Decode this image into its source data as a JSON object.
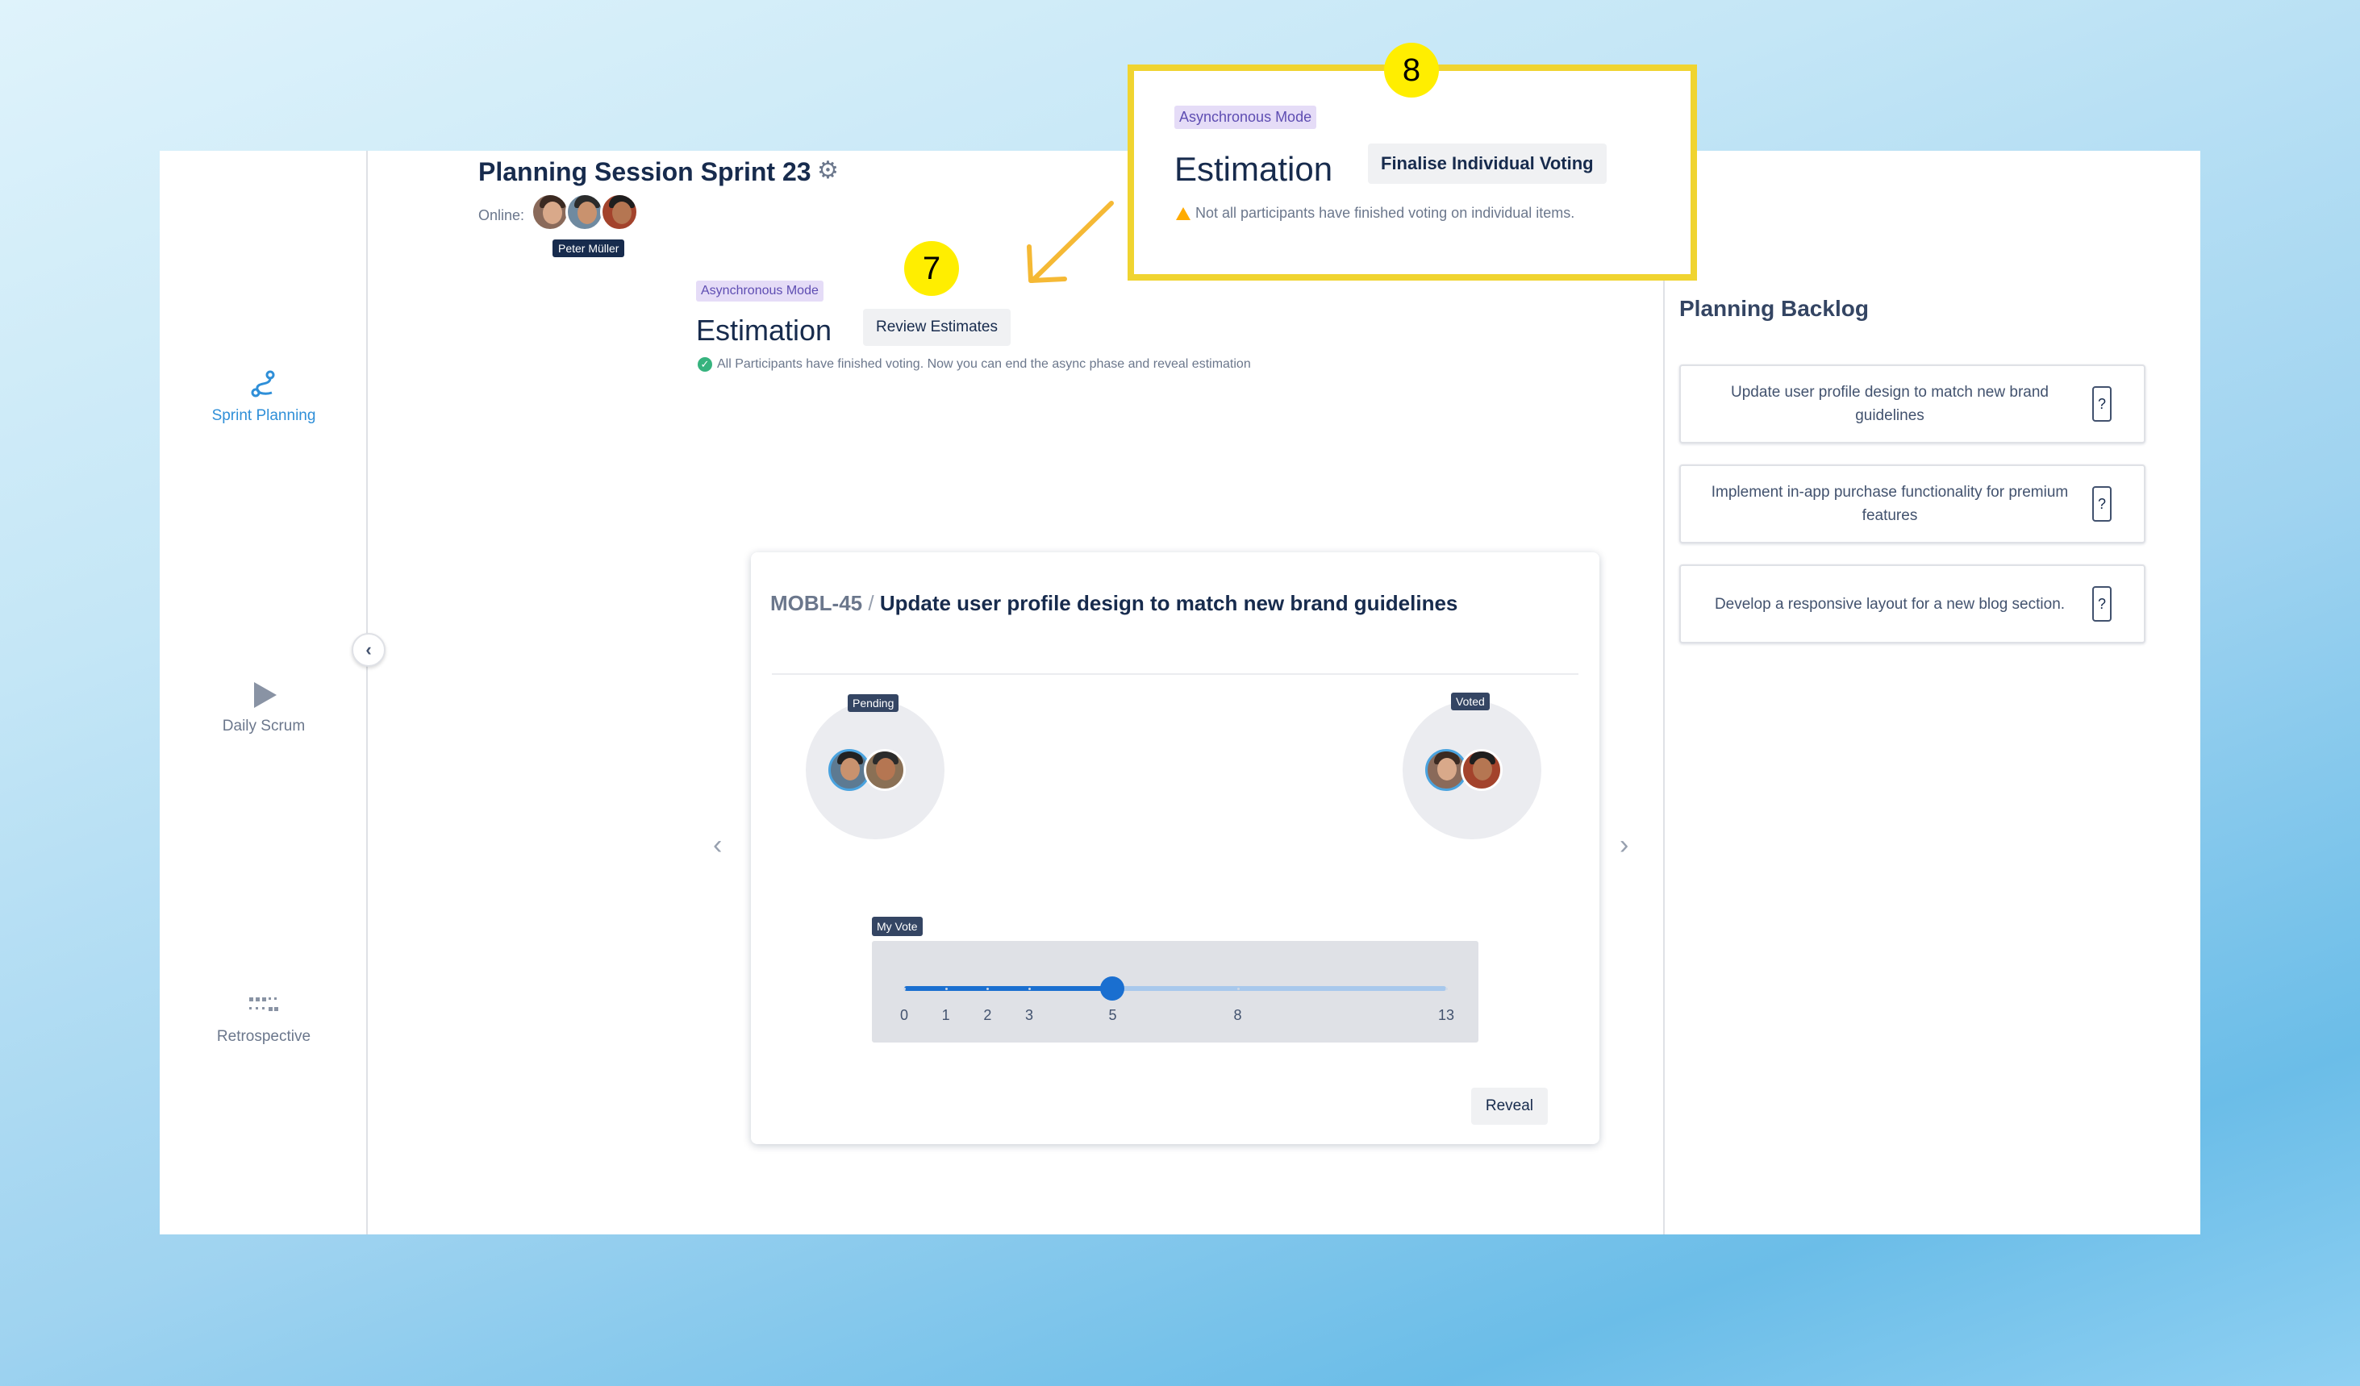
{
  "session": {
    "title": "Planning Session Sprint 23",
    "settings_icon": "gear-icon",
    "online_label": "Online:",
    "online_users": [
      {
        "name": "participant-1",
        "tooltip": ""
      },
      {
        "name": "Peter Müller",
        "tooltip": "Peter Müller"
      },
      {
        "name": "participant-3",
        "tooltip": ""
      }
    ],
    "hover_tooltip": "Peter Müller"
  },
  "nav": {
    "items": [
      {
        "label": "Sprint Planning",
        "icon": "sprint-planning-icon",
        "active": true
      },
      {
        "label": "Daily Scrum",
        "icon": "play-icon",
        "active": false
      },
      {
        "label": "Retrospective",
        "icon": "grid-dots-icon",
        "active": false
      }
    ],
    "collapse_icon": "chevron-left-icon"
  },
  "estimation": {
    "mode_badge": "Asynchronous Mode",
    "heading": "Estimation",
    "action_button": "Review Estimates",
    "status_text": "All Participants have finished voting. Now you can end the async phase and reveal estimation"
  },
  "card": {
    "issue_key": "MOBL-45",
    "separator": "/",
    "issue_title": "Update user profile design to match new brand guidelines",
    "pending_label": "Pending",
    "voted_label": "Voted",
    "pending_count": 2,
    "voted_count": 2,
    "my_vote_label": "My Vote",
    "scale": [
      "0",
      "1",
      "2",
      "3",
      "5",
      "8",
      "13"
    ],
    "selected_vote": "5",
    "reveal_button": "Reveal",
    "prev_icon": "chevron-left-icon",
    "next_icon": "chevron-right-icon"
  },
  "backlog": {
    "title": "Planning Backlog",
    "items": [
      {
        "text": "Update user profile design to match new brand guidelines",
        "estimate": "?"
      },
      {
        "text": "Implement in-app purchase functionality for premium features",
        "estimate": "?"
      },
      {
        "text": "Develop a responsive layout for a new blog section.",
        "estimate": "?"
      }
    ]
  },
  "annotations": {
    "step7": "7",
    "step8": "8",
    "callout": {
      "mode_badge": "Asynchronous Mode",
      "heading": "Estimation",
      "action_button": "Finalise Individual Voting",
      "warning_text": "Not all participants have finished voting on individual items."
    },
    "highlight_color": "#f0d430",
    "badge_color": "#ffee00"
  }
}
